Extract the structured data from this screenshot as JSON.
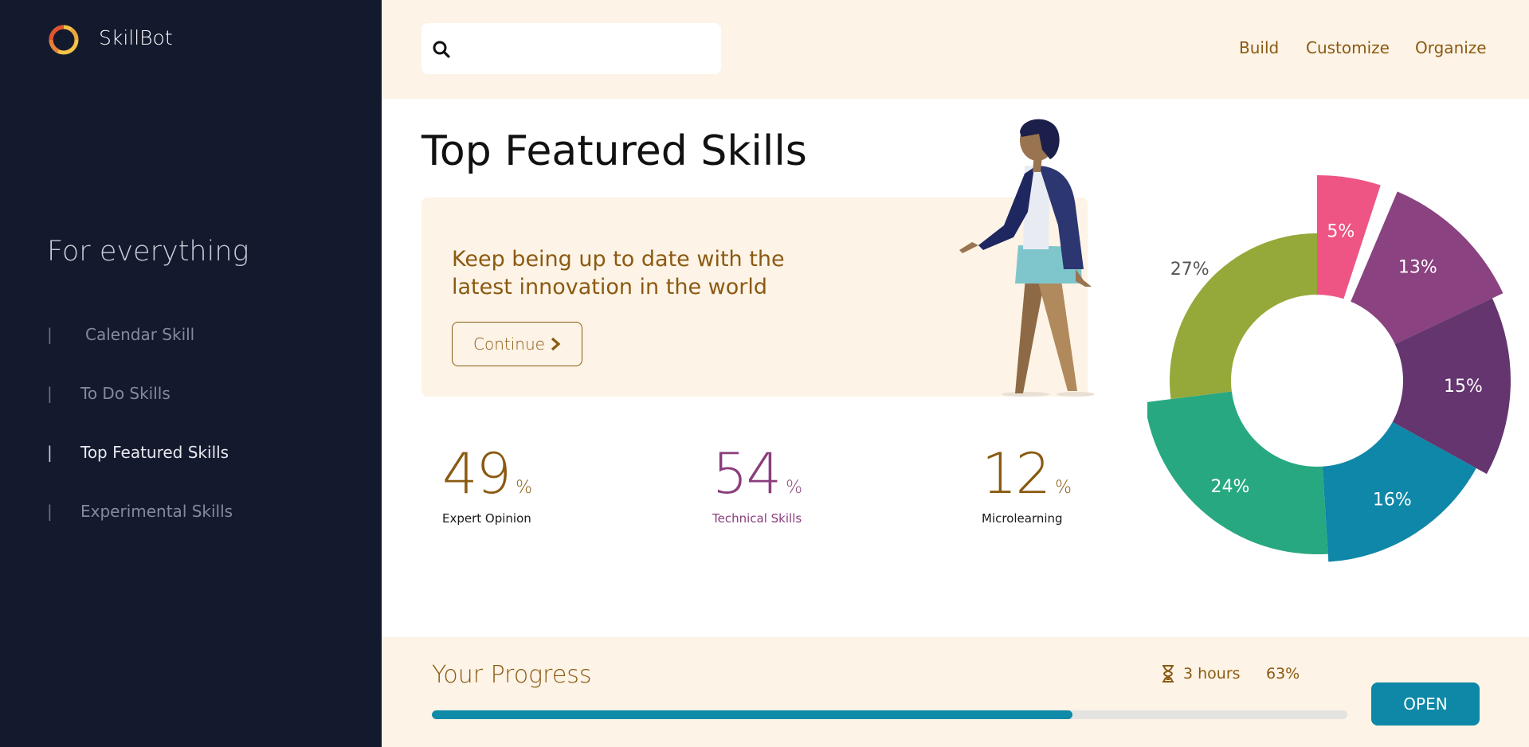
{
  "brand": {
    "name": "SkillBot",
    "logo_icon": "ring-logo-icon"
  },
  "sidebar": {
    "tagline": "For everything",
    "items": [
      {
        "label": "Calendar Skill",
        "marker": "|"
      },
      {
        "label": "To Do Skills",
        "marker": "|"
      },
      {
        "label": "Top Featured Skills",
        "marker": "|",
        "active": true
      },
      {
        "label": "Experimental Skills",
        "marker": "|"
      }
    ]
  },
  "header": {
    "search": {
      "placeholder": "",
      "value": "",
      "icon": "search-icon"
    },
    "nav": [
      "Build",
      "Customize",
      "Organize"
    ]
  },
  "main": {
    "title": "Top Featured Skills",
    "banner": {
      "text": "Keep being up to date with the latest innovation in the world",
      "button_label": "Continue",
      "button_icon": "chevron-right-icon"
    },
    "stats": [
      {
        "value": "49",
        "unit": "%",
        "label": "Expert Opinion",
        "color": "#8a5a12",
        "label_color": "#1a1a1a"
      },
      {
        "value": "54",
        "unit": "%",
        "label": "Technical Skills",
        "color": "#8a3e7c",
        "label_color": "#8a3e7c"
      },
      {
        "value": "12",
        "unit": "%",
        "label": "Microlearning",
        "color": "#8a5a12",
        "label_color": "#1a1a1a"
      }
    ]
  },
  "chart_data": {
    "type": "pie",
    "variant": "rose-donut",
    "labels": [
      "5%",
      "13%",
      "15%",
      "16%",
      "24%",
      "27%"
    ],
    "values": [
      5,
      13,
      15,
      16,
      24,
      27
    ],
    "colors": [
      "#ee5584",
      "#8a4280",
      "#64356f",
      "#0f87a8",
      "#27a880",
      "#95a83a"
    ]
  },
  "progress": {
    "title": "Your Progress",
    "time_icon": "hourglass-icon",
    "time": "3 hours",
    "percent_text": "63%",
    "fill_fraction": 0.7,
    "button_label": "OPEN"
  },
  "colors": {
    "sidebar_bg": "#141a2e",
    "accent_brown": "#8a5a12",
    "cream": "#fdf3e6",
    "teal": "#0e88a6"
  }
}
